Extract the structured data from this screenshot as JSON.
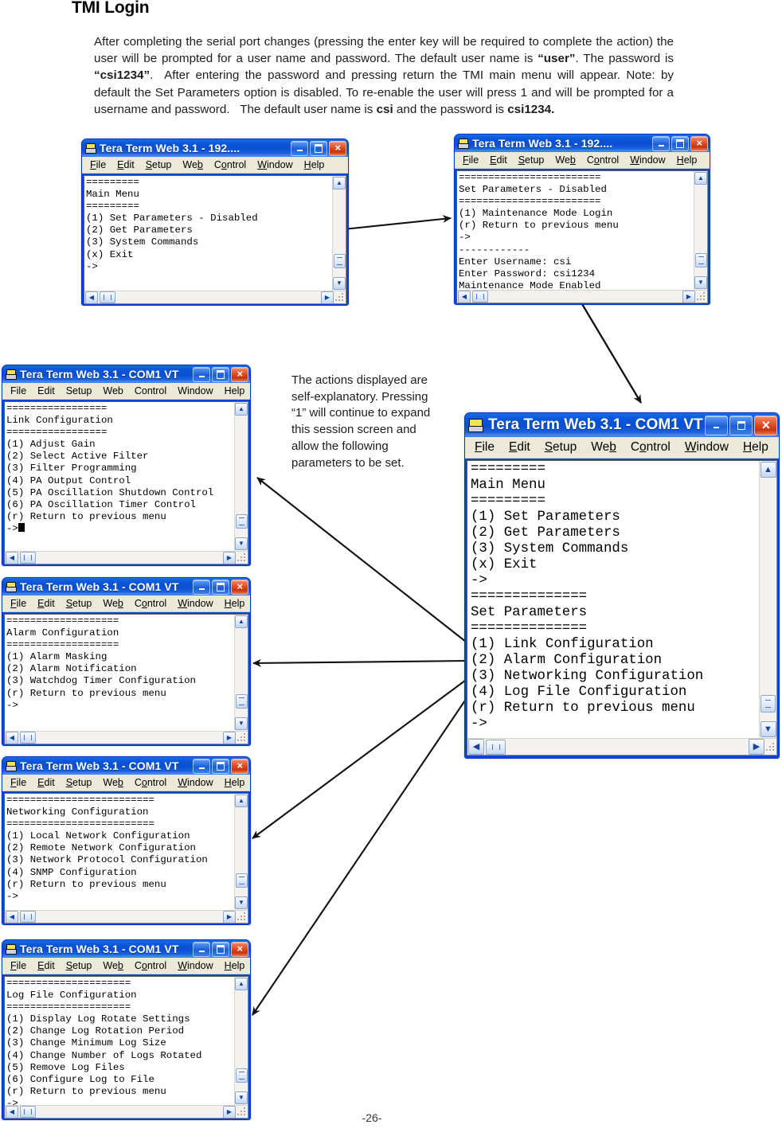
{
  "document": {
    "title": "TMI Login",
    "paragraph": "After completing the serial port changes (pressing the enter key will be required to complete the action) the user will be prompted for a user name and password. The default user name is “user”. The password is “csi1234”.  After entering the password and pressing return the TMI main menu will appear. Note: by default the Set Parameters option is disabled. To re-enable the user will press 1 and will be prompted for a username and password.   The default user name is csi and the password is csi1234.",
    "page_number": "-26-",
    "callout": "The actions displayed are self-explanatory. Pressing “1” will continue to expand this session screen and allow the following parameters to be set."
  },
  "menu_bar": {
    "items": [
      "File",
      "Edit",
      "Setup",
      "Web",
      "Control",
      "Window",
      "Help"
    ]
  },
  "window_buttons": {
    "minimize": "minimize-button",
    "maximize": "maximize-button",
    "close": "×"
  },
  "windows": [
    {
      "id": "main-menu-disabled",
      "title": "Tera Term Web 3.1 - 192....",
      "screen": "=========\nMain Menu\n=========\n(1) Set Parameters - Disabled\n(2) Get Parameters\n(3) System Commands\n(x) Exit\n->"
    },
    {
      "id": "set-parameters-maintenance-login",
      "title": "Tera Term Web 3.1 - 192....",
      "screen": "========================\nSet Parameters - Disabled\n========================\n(1) Maintenance Mode Login\n(r) Return to previous menu\n->\n------------\nEnter Username: csi\nEnter Password: csi1234\nMaintenance Mode Enabled\n========="
    },
    {
      "id": "link-configuration",
      "title": "Tera Term Web 3.1 -  COM1 VT",
      "screen": "=================\nLink Configuration\n=================\n(1) Adjust Gain\n(2) Select Active Filter\n(3) Filter Programming\n(4) PA Output Control\n(5) PA Oscillation Shutdown Control\n(6) PA Oscillation Timer Control\n(r) Return to previous menu\n->"
    },
    {
      "id": "alarm-configuration",
      "title": "Tera Term Web 3.1 - COM1 VT",
      "screen": "===================\nAlarm Configuration\n===================\n(1) Alarm Masking\n(2) Alarm Notification\n(3) Watchdog Timer Configuration\n(r) Return to previous menu\n->"
    },
    {
      "id": "networking-configuration",
      "title": "Tera Term Web 3.1 - COM1 VT",
      "screen": "=========================\nNetworking Configuration\n=========================\n(1) Local Network Configuration\n(2) Remote Network Configuration\n(3) Network Protocol Configuration\n(4) SNMP Configuration\n(r) Return to previous menu\n->"
    },
    {
      "id": "log-file-configuration",
      "title": "Tera Term Web 3.1  - COM1 VT",
      "screen": "=====================\nLog File Configuration\n=====================\n(1) Display Log Rotate Settings\n(2) Change Log Rotation Period\n(3) Change Minimum Log Size\n(4) Change Number of Logs Rotated\n(5) Remove Log Files\n(6) Configure Log to File\n(r) Return to previous menu\n->"
    },
    {
      "id": "main-menu-set-parameters",
      "title": "Tera Term Web 3.1 - COM1 VT",
      "screen": "=========\nMain Menu\n=========\n(1) Set Parameters\n(2) Get Parameters\n(3) System Commands\n(x) Exit\n->\n==============\nSet Parameters\n==============\n(1) Link Configuration\n(2) Alarm Configuration\n(3) Networking Configuration\n(4) Log File Configuration\n(r) Return to previous menu\n->"
    }
  ],
  "colors": {
    "titlebar_blue": "#0a4fd0",
    "close_red": "#d2421a",
    "menu_face": "#ece9d8",
    "terminal_bg": "#ffffff",
    "terminal_fg": "#000000"
  }
}
